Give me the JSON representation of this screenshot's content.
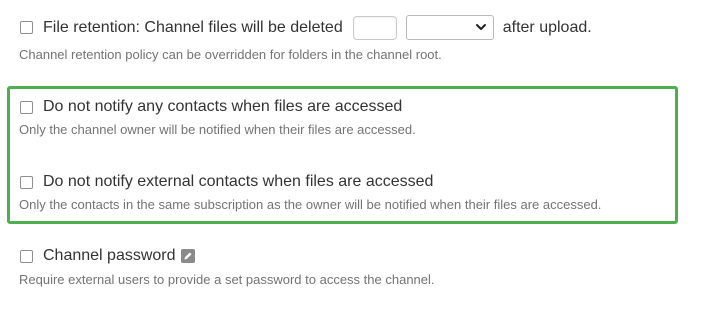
{
  "retention": {
    "label_before": "File retention: Channel files will be deleted",
    "input_value": "",
    "select_value": "",
    "label_after": "after upload.",
    "help": "Channel retention policy can be overridden for folders in the channel root."
  },
  "notify_any": {
    "label": "Do not notify any contacts when files are accessed",
    "help": "Only the channel owner will be notified when their files are accessed."
  },
  "notify_external": {
    "label": "Do not notify external contacts when files are accessed",
    "help": "Only the contacts in the same subscription as the owner will be notified when their files are accessed."
  },
  "password": {
    "label": "Channel password",
    "help": "Require external users to provide a set password to access the channel."
  },
  "icons": {
    "dropdown": "chevron-down-icon",
    "edit": "pencil-edit-icon"
  },
  "colors": {
    "highlight_border": "#4caf50",
    "help_text": "#737373",
    "label_text": "#333333"
  }
}
